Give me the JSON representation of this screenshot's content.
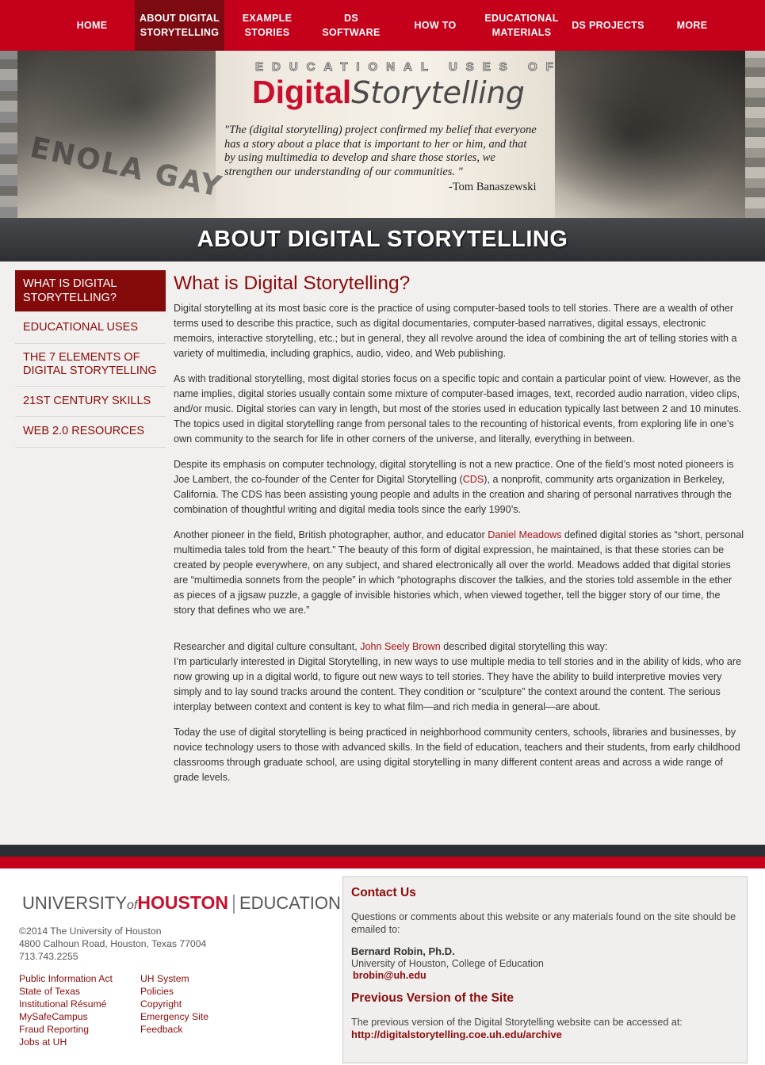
{
  "nav": {
    "items": [
      {
        "label": "HOME"
      },
      {
        "label": "ABOUT DIGITAL STORYTELLING"
      },
      {
        "label": "EXAMPLE STORIES"
      },
      {
        "label": "DS SOFTWARE"
      },
      {
        "label": "HOW TO"
      },
      {
        "label": "EDUCATIONAL MATERIALS"
      },
      {
        "label": "DS PROJECTS"
      },
      {
        "label": "MORE"
      }
    ],
    "active": "ABOUT DIGITAL STORYTELLING"
  },
  "banner": {
    "kicker": "EDUCATIONAL USES OF",
    "logo_red": "Digital",
    "logo_grey": "Storytelling",
    "quote": "\"The (digital storytelling) project confirmed my belief that everyone has a story about a place that is important to her or him, and that by using multimedia to develop and share those stories, we strengthen our understanding of our communities. \"",
    "quote_author": "-Tom Banaszewski",
    "photo_text": "ENOLA GAY"
  },
  "page_title": "ABOUT DIGITAL STORYTELLING",
  "sidebar": {
    "items": [
      {
        "label": "WHAT IS DIGITAL STORYTELLING?"
      },
      {
        "label": "EDUCATIONAL USES"
      },
      {
        "label": "THE 7 ELEMENTS OF DIGITAL STORYTELLING"
      },
      {
        "label": "21ST CENTURY SKILLS"
      },
      {
        "label": "WEB 2.0 RESOURCES"
      }
    ]
  },
  "content": {
    "heading": "What is Digital Storytelling?",
    "p1": "Digital storytelling at its most basic core is the practice of using computer-based tools to tell stories. There are a wealth of other terms used to describe this practice, such as digital documentaries, computer-based narratives, digital essays, electronic memoirs, interactive storytelling, etc.; but in general, they all revolve around the idea of combining the art of telling stories with a variety of multimedia, including graphics, audio, video, and Web publishing.",
    "p2": "As with traditional storytelling, most digital stories focus on a specific topic and contain a particular point of view. However, as the name implies, digital stories usually contain some mixture of computer-based images, text, recorded audio narration, video clips, and/or music. Digital stories can vary in length, but most of the stories used in education typically last between 2 and 10 minutes. The topics used in digital storytelling range from personal tales to the recounting of historical events, from exploring life in one’s own community to the search for life in other corners of the universe, and literally, everything in between.",
    "p3_a": "Despite its emphasis on computer technology, digital storytelling is not a new practice. One of the field’s most noted pioneers is Joe Lambert, the co-founder of the Center for Digital Storytelling (",
    "p3_link": "CDS",
    "p3_b": "), a nonprofit, community arts organization in Berkeley, California. The CDS has been assisting young people and adults in the creation and sharing of personal narratives through the combination of thoughtful writing and digital media tools since the early 1990’s.",
    "p4_a": "Another pioneer in the field, British photographer, author, and educator ",
    "p4_link": "Daniel Meadows",
    "p4_b": " defined digital stories as “short, personal multimedia tales told from the heart.” The beauty of this form of digital expression, he maintained, is that these stories can be created by people everywhere, on any subject, and shared electronically all over the world. Meadows added that digital stories are “multimedia sonnets from the people” in which “photographs discover the talkies, and the stories told assemble in the ether as pieces of a jigsaw puzzle, a gaggle of invisible histories which, when viewed together, tell the bigger story of our time, the story that defines who we are.”",
    "p5_a": "Researcher and digital culture consultant, ",
    "p5_link": "John Seely Brown",
    "p5_b": " described digital storytelling this way:",
    "p5_quote": "I’m particularly interested in Digital Storytelling, in new ways to use multiple media to tell stories and in the ability of kids, who are now growing up in a digital world, to figure out new ways to tell stories. They have the ability to build interpretive movies very simply and to lay sound tracks around the content. They condition or “sculpture” the context around the content. The serious interplay between context and content is key to what film—and rich media in general—are about.",
    "p6": "Today the use of digital storytelling is being practiced in neighborhood community centers, schools, libraries and businesses, by novice technology users to those with advanced skills. In the field of education, teachers and their students, from early childhood classrooms through graduate school, are using digital storytelling in many different content areas and across a wide range of grade levels."
  },
  "footer": {
    "logo": {
      "university": "UNIVERSITY",
      "of": "of",
      "houston": "HOUSTON",
      "college": "EDUCATION"
    },
    "copyright": "©2014 The University of Houston",
    "address": "4800 Calhoun Road, Houston, Texas 77004",
    "phone": "713.743.2255",
    "links_col1": [
      "Public Information Act",
      "State of Texas",
      "Institutional Résumé",
      "MySafeCampus",
      "Fraud Reporting",
      "Jobs at UH"
    ],
    "links_col2": [
      "UH System",
      "Policies",
      "Copyright",
      "Emergency Site",
      "Feedback"
    ],
    "contact": {
      "heading": "Contact Us",
      "text": "Questions or comments about this website or any materials found on the site should be emailed to:",
      "name": "Bernard Robin, Ph.D.",
      "org": "University of Houston, College of Education",
      "email": "brobin@uh.edu"
    },
    "previous": {
      "heading": "Previous Version of the Site",
      "text": "The previous version of the Digital Storytelling website can be accessed at:",
      "url": "http://digitalstorytelling.coe.uh.edu/archive"
    }
  },
  "colors": {
    "nav_red": "#c4001a",
    "nav_active": "#7d0a12",
    "heading_maroon": "#8b0b0b",
    "title_bar": "#2d2f33"
  }
}
